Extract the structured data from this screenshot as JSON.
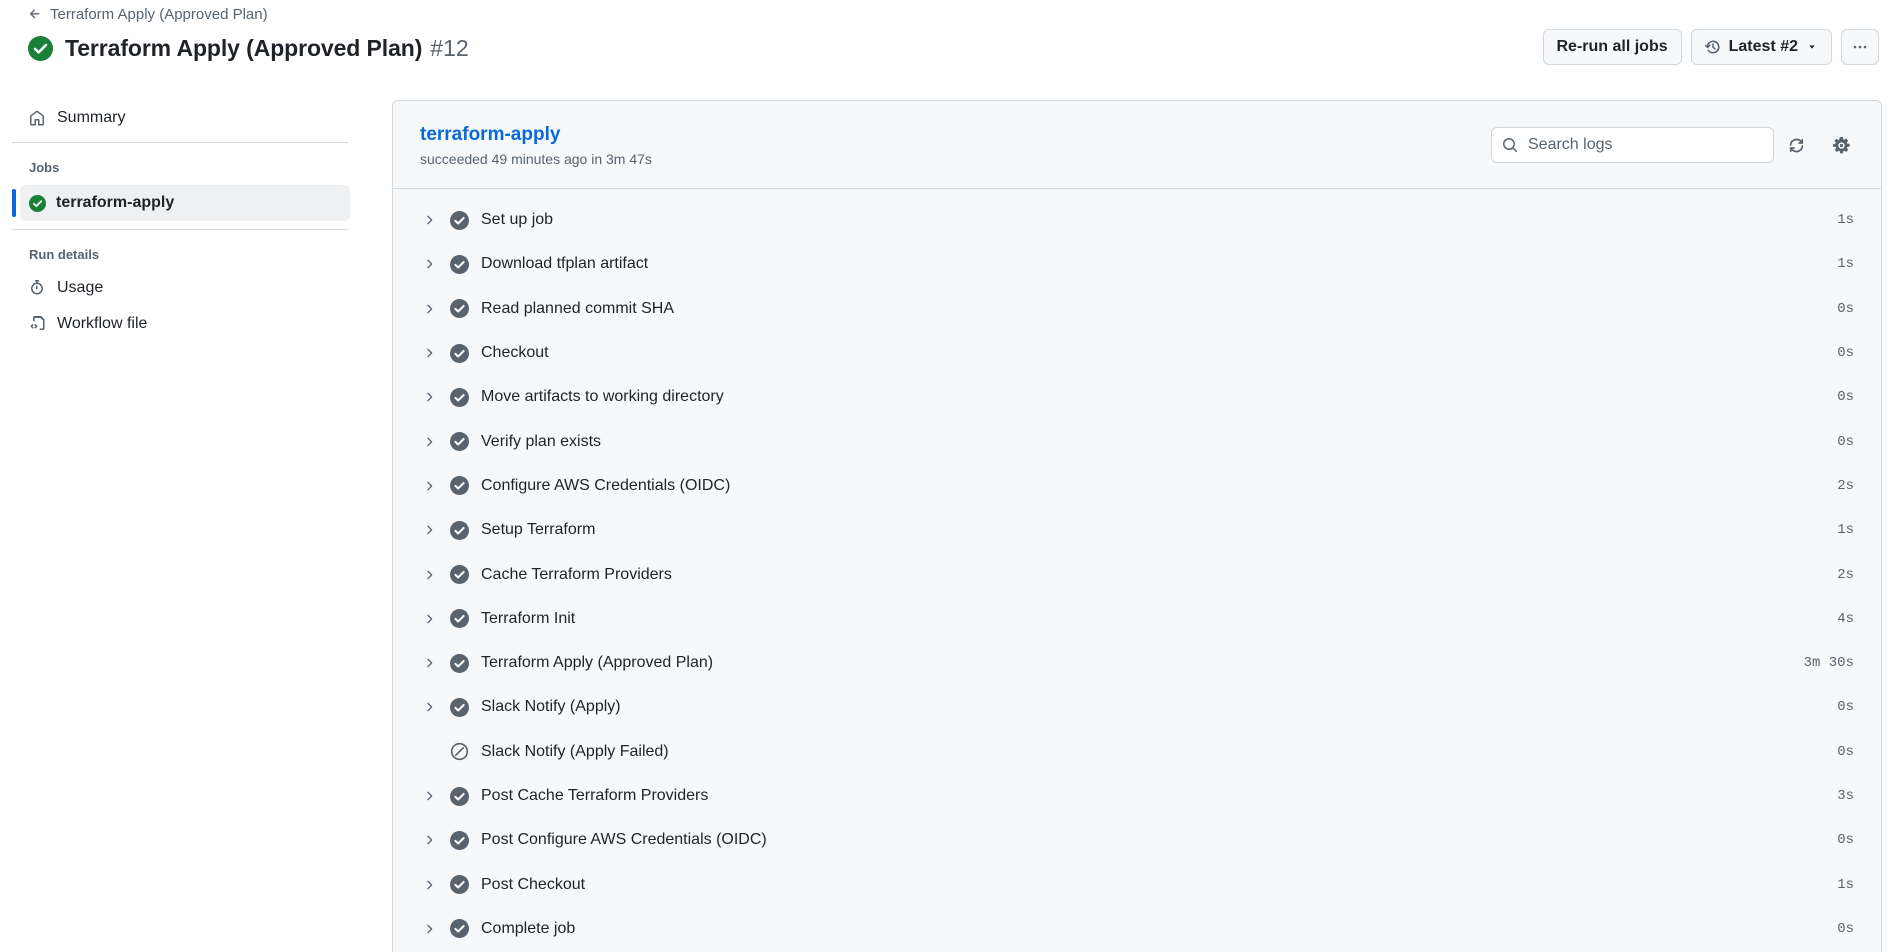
{
  "breadcrumb": {
    "label": "Terraform Apply (Approved Plan)"
  },
  "header": {
    "title": "Terraform Apply (Approved Plan)",
    "run_number": "#12",
    "rerun_label": "Re-run all jobs",
    "attempt_label": "Latest #2"
  },
  "sidebar": {
    "summary_label": "Summary",
    "jobs_heading": "Jobs",
    "job_label": "terraform-apply",
    "run_details_heading": "Run details",
    "usage_label": "Usage",
    "workflow_file_label": "Workflow file"
  },
  "job": {
    "title": "terraform-apply",
    "meta": "succeeded 49 minutes ago in 3m 47s",
    "search_placeholder": "Search logs"
  },
  "steps": [
    {
      "name": "Set up job",
      "duration": "1s",
      "status": "success"
    },
    {
      "name": "Download tfplan artifact",
      "duration": "1s",
      "status": "success"
    },
    {
      "name": "Read planned commit SHA",
      "duration": "0s",
      "status": "success"
    },
    {
      "name": "Checkout",
      "duration": "0s",
      "status": "success"
    },
    {
      "name": "Move artifacts to working directory",
      "duration": "0s",
      "status": "success"
    },
    {
      "name": "Verify plan exists",
      "duration": "0s",
      "status": "success"
    },
    {
      "name": "Configure AWS Credentials (OIDC)",
      "duration": "2s",
      "status": "success"
    },
    {
      "name": "Setup Terraform",
      "duration": "1s",
      "status": "success"
    },
    {
      "name": "Cache Terraform Providers",
      "duration": "2s",
      "status": "success"
    },
    {
      "name": "Terraform Init",
      "duration": "4s",
      "status": "success"
    },
    {
      "name": "Terraform Apply (Approved Plan)",
      "duration": "3m 30s",
      "status": "success"
    },
    {
      "name": "Slack Notify (Apply)",
      "duration": "0s",
      "status": "success"
    },
    {
      "name": "Slack Notify (Apply Failed)",
      "duration": "0s",
      "status": "skipped"
    },
    {
      "name": "Post Cache Terraform Providers",
      "duration": "3s",
      "status": "success"
    },
    {
      "name": "Post Configure AWS Credentials (OIDC)",
      "duration": "0s",
      "status": "success"
    },
    {
      "name": "Post Checkout",
      "duration": "1s",
      "status": "success"
    },
    {
      "name": "Complete job",
      "duration": "0s",
      "status": "success"
    }
  ],
  "colors": {
    "success_green": "#1a7f37",
    "step_check": "#59636e",
    "link_blue": "#0969da",
    "border": "#d1d9e0"
  }
}
